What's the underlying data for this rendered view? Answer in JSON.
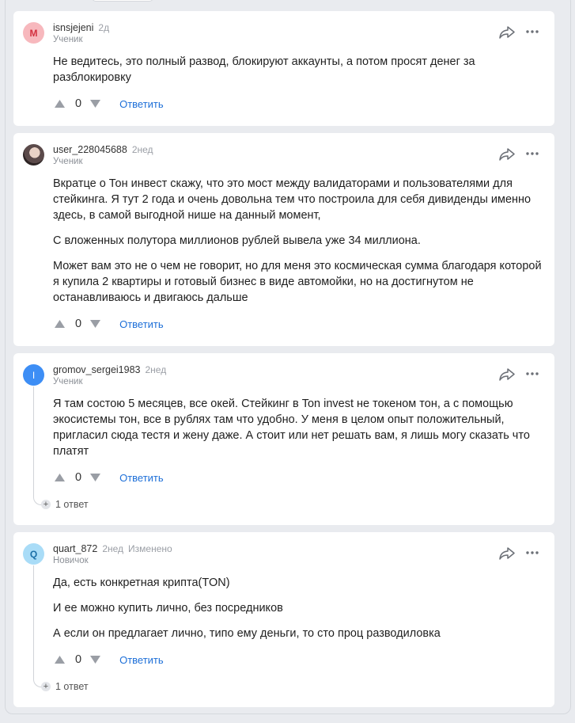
{
  "colors": {
    "link": "#1d6fd8",
    "card_bg": "#ffffff",
    "page_bg": "#e9ebef",
    "meta": "#9a9ea5"
  },
  "comments": [
    {
      "avatar_letter": "M",
      "username": "isnsjejeni",
      "time": "2д",
      "edited": "",
      "rank": "Ученик",
      "paragraphs": [
        "Не ведитесь, это полный развод, блокируют аккаунты, а потом просят денег за разблокировку"
      ],
      "votes": "0",
      "reply_label": "Ответить"
    },
    {
      "avatar_letter": "",
      "username": "user_228045688",
      "time": "2нед",
      "edited": "",
      "rank": "Ученик",
      "paragraphs": [
        "Вкратце о Тон инвест скажу, что это мост между валидаторами и пользователями для стейкинга. Я тут 2 года и очень довольна тем что построила для себя дивиденды именно здесь, в самой выгодной нише на данный момент,",
        "С вложенных полутора миллионов рублей вывела уже 34 миллиона.",
        "Может вам это не о чем не говорит, но для меня это космическая сумма благодаря которой я купила 2 квартиры и готовый бизнес в виде автомойки, но на достигнутом не останавливаюсь и двигаюсь дальше"
      ],
      "votes": "0",
      "reply_label": "Ответить"
    },
    {
      "avatar_letter": "I",
      "username": "gromov_sergei1983",
      "time": "2нед",
      "edited": "",
      "rank": "Ученик",
      "paragraphs": [
        "Я там состою 5 месяцев, все окей. Стейкинг в Ton invest не токеном тон, а с помощью экосистемы тон, все в рублях там что удобно. У меня в целом опыт положительный, пригласил сюда тестя и жену даже. А стоит или нет решать вам, я лишь могу сказать что платят"
      ],
      "votes": "0",
      "reply_label": "Ответить",
      "replies_label": "1 ответ"
    },
    {
      "avatar_letter": "Q",
      "username": "quart_872",
      "time": "2нед",
      "edited": "Изменено",
      "rank": "Новичок",
      "paragraphs": [
        "Да, есть конкретная крипта(TON)",
        "И ее можно купить лично, без посредников",
        "А если он предлагает лично, типо ему деньги, то сто проц разводиловка"
      ],
      "votes": "0",
      "reply_label": "Ответить",
      "replies_label": "1 ответ"
    }
  ],
  "icons": {
    "share": "share-icon",
    "more": "more-icon",
    "upvote": "upvote-icon",
    "downvote": "downvote-icon",
    "expand": "plus-icon"
  }
}
